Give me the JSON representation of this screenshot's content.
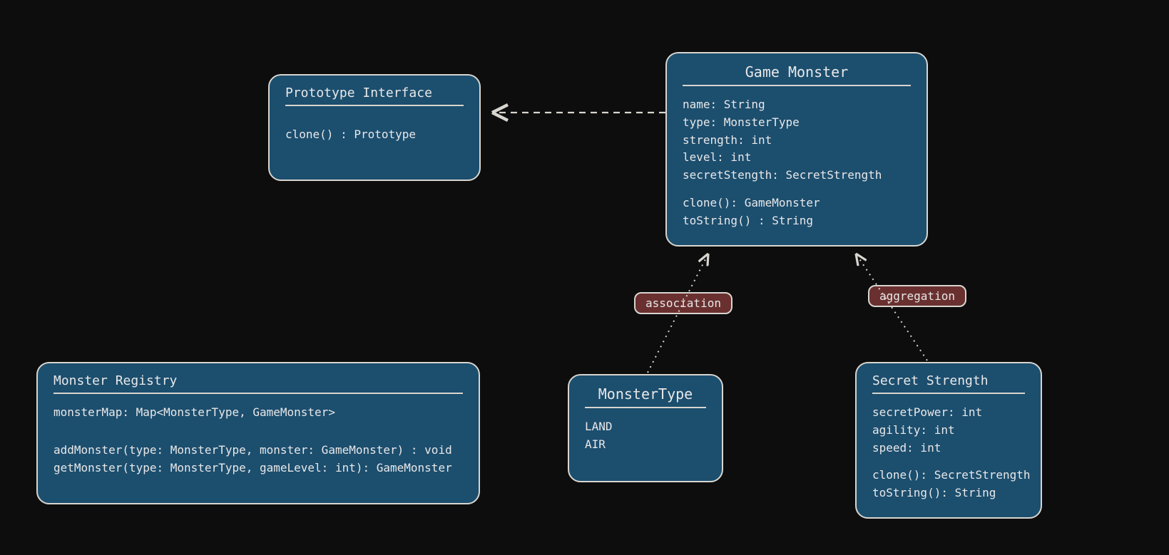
{
  "prototype": {
    "title": "Prototype Interface",
    "m0": "clone() : Prototype"
  },
  "gamemonster": {
    "title": "Game Monster",
    "a0": "name: String",
    "a1": "type: MonsterType",
    "a2": "strength: int",
    "a3": "level: int",
    "a4": "secretStength: SecretStrength",
    "m0": "clone(): GameMonster",
    "m1": "toString() : String"
  },
  "registry": {
    "title": "Monster Registry",
    "a0": "monsterMap: Map<MonsterType, GameMonster>",
    "m0": "addMonster(type: MonsterType, monster: GameMonster) : void",
    "m1": "getMonster(type: MonsterType, gameLevel: int): GameMonster"
  },
  "monstertype": {
    "title": "MonsterType",
    "v0": "LAND",
    "v1": "AIR"
  },
  "secret": {
    "title": "Secret Strength",
    "a0": "secretPower: int",
    "a1": "agility: int",
    "a2": "speed: int",
    "m0": "clone(): SecretStrength",
    "m1": "toString(): String"
  },
  "labels": {
    "association": "association",
    "aggregation": "aggregation"
  }
}
